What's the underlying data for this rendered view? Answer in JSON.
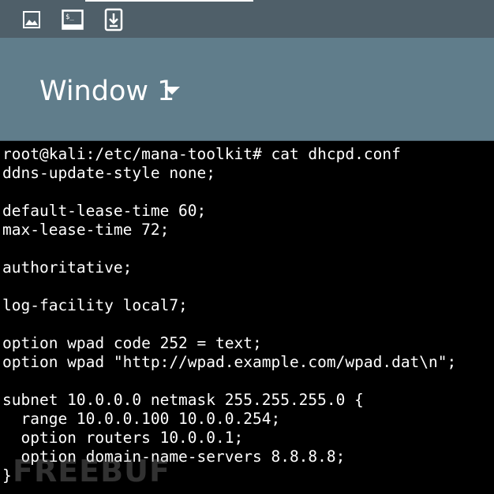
{
  "toolbar": {
    "icons": [
      "image-icon",
      "terminal-icon",
      "download-icon"
    ]
  },
  "header": {
    "window_title": "Window 1"
  },
  "terminal": {
    "lines": [
      "root@kali:/etc/mana-toolkit# cat dhcpd.conf",
      "ddns-update-style none;",
      "",
      "default-lease-time 60;",
      "max-lease-time 72;",
      "",
      "authoritative;",
      "",
      "log-facility local7;",
      "",
      "option wpad code 252 = text;",
      "option wpad \"http://wpad.example.com/wpad.dat\\n\";",
      "",
      "subnet 10.0.0.0 netmask 255.255.255.0 {",
      "  range 10.0.0.100 10.0.0.254;",
      "  option routers 10.0.0.1;",
      "  option domain-name-servers 8.8.8.8;",
      "}"
    ]
  },
  "watermark": {
    "text": "FREEBUF"
  }
}
